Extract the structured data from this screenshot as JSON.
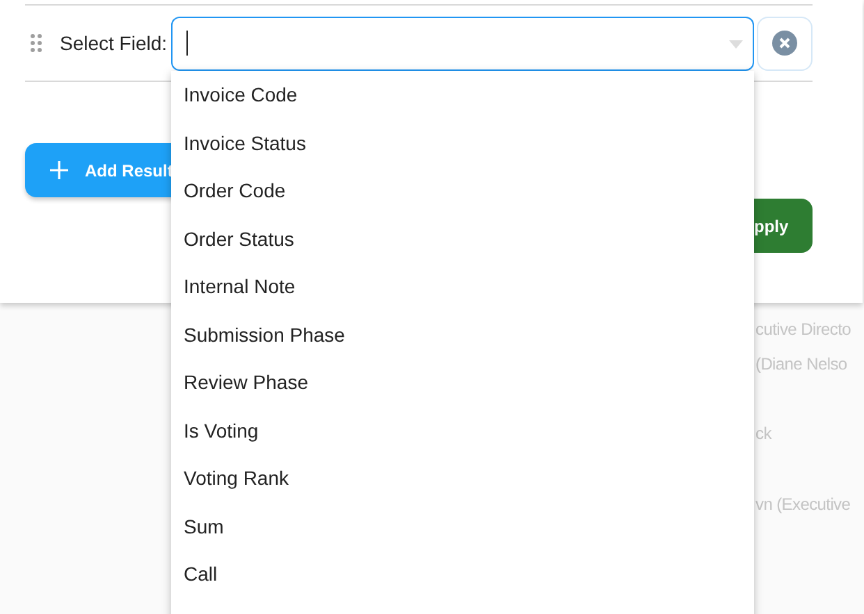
{
  "filter_row": {
    "label": "Select Field:"
  },
  "dropdown": {
    "options": [
      {
        "label": "Invoice Code",
        "selected": false
      },
      {
        "label": "Invoice Status",
        "selected": false
      },
      {
        "label": "Order Code",
        "selected": false
      },
      {
        "label": "Order Status",
        "selected": false
      },
      {
        "label": "Internal Note",
        "selected": false
      },
      {
        "label": "Submission Phase",
        "selected": false
      },
      {
        "label": "Review Phase",
        "selected": false
      },
      {
        "label": "Is Voting",
        "selected": false
      },
      {
        "label": "Voting Rank",
        "selected": false
      },
      {
        "label": "Sum",
        "selected": false
      },
      {
        "label": "Call",
        "selected": false
      }
    ]
  },
  "add_button": {
    "label": "Add Result"
  },
  "apply_button": {
    "label": "pply"
  },
  "background_list": [
    "cutive Directo",
    "(Diane Nelso",
    "ck",
    "vn (Executive"
  ]
}
